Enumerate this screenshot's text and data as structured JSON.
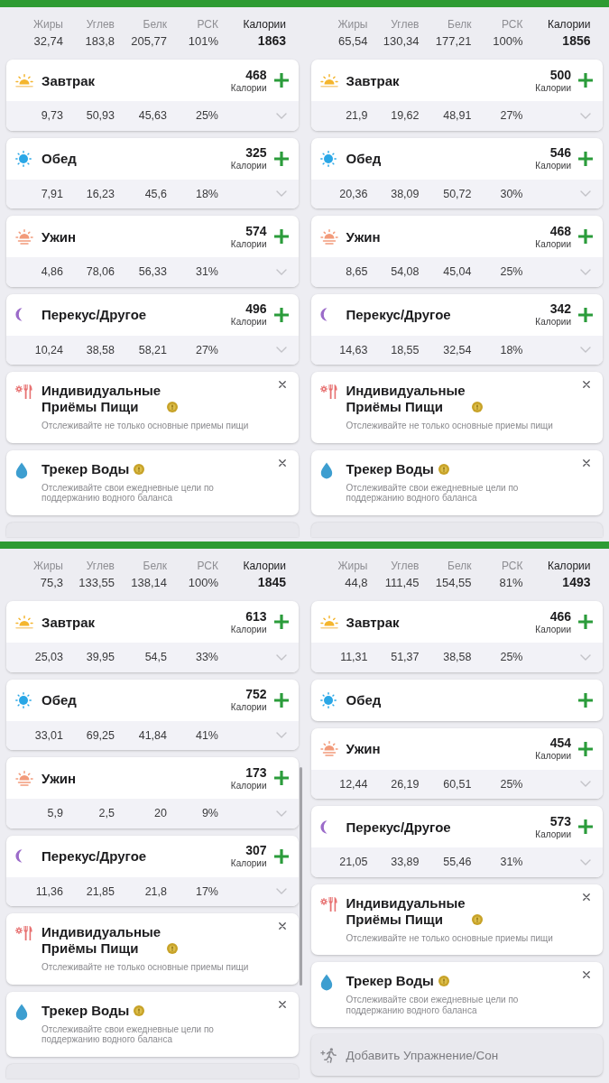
{
  "panels": [
    {
      "header": {
        "columns": [
          {
            "label": "Жиры",
            "value": "32,74"
          },
          {
            "label": "Углев",
            "value": "183,8"
          },
          {
            "label": "Белк",
            "value": "205,77"
          },
          {
            "label": "РСК",
            "value": "101%"
          },
          {
            "label": "Калории",
            "value": "1863"
          }
        ]
      },
      "meals": [
        {
          "kind": "breakfast",
          "name": "Завтрак",
          "calories": "468",
          "calories_label": "Калории",
          "macros": [
            "9,73",
            "50,93",
            "45,63",
            "25%"
          ]
        },
        {
          "kind": "lunch",
          "name": "Обед",
          "calories": "325",
          "calories_label": "Калории",
          "macros": [
            "7,91",
            "16,23",
            "45,6",
            "18%"
          ]
        },
        {
          "kind": "dinner",
          "name": "Ужин",
          "calories": "574",
          "calories_label": "Калории",
          "macros": [
            "4,86",
            "78,06",
            "56,33",
            "31%"
          ]
        },
        {
          "kind": "snack",
          "name": "Перекус/Другое",
          "calories": "496",
          "calories_label": "Калории",
          "macros": [
            "10,24",
            "38,58",
            "58,21",
            "27%"
          ]
        }
      ],
      "promos": [
        {
          "kind": "custom_meals",
          "title": "Индивидуальные Приёмы Пищи",
          "description": "Отслеживайте не только основные приемы пищи"
        },
        {
          "kind": "water",
          "title": "Трекер Воды",
          "description": "Отслеживайте свои ежедневные цели по поддержанию водного баланса"
        }
      ],
      "exercise_button": {
        "cut_off": true
      }
    },
    {
      "header": {
        "columns": [
          {
            "label": "Жиры",
            "value": "65,54"
          },
          {
            "label": "Углев",
            "value": "130,34"
          },
          {
            "label": "Белк",
            "value": "177,21"
          },
          {
            "label": "РСК",
            "value": "100%"
          },
          {
            "label": "Калории",
            "value": "1856"
          }
        ]
      },
      "meals": [
        {
          "kind": "breakfast",
          "name": "Завтрак",
          "calories": "500",
          "calories_label": "Калории",
          "macros": [
            "21,9",
            "19,62",
            "48,91",
            "27%"
          ]
        },
        {
          "kind": "lunch",
          "name": "Обед",
          "calories": "546",
          "calories_label": "Калории",
          "macros": [
            "20,36",
            "38,09",
            "50,72",
            "30%"
          ]
        },
        {
          "kind": "dinner",
          "name": "Ужин",
          "calories": "468",
          "calories_label": "Калории",
          "macros": [
            "8,65",
            "54,08",
            "45,04",
            "25%"
          ]
        },
        {
          "kind": "snack",
          "name": "Перекус/Другое",
          "calories": "342",
          "calories_label": "Калории",
          "macros": [
            "14,63",
            "18,55",
            "32,54",
            "18%"
          ]
        }
      ],
      "promos": [
        {
          "kind": "custom_meals",
          "title": "Индивидуальные Приёмы Пищи",
          "description": "Отслеживайте не только основные приемы пищи"
        },
        {
          "kind": "water",
          "title": "Трекер Воды",
          "description": "Отслеживайте свои ежедневные цели по поддержанию водного баланса"
        }
      ],
      "exercise_button": {
        "cut_off": true
      }
    },
    {
      "header": {
        "columns": [
          {
            "label": "Жиры",
            "value": "75,3"
          },
          {
            "label": "Углев",
            "value": "133,55"
          },
          {
            "label": "Белк",
            "value": "138,14"
          },
          {
            "label": "РСК",
            "value": "100%"
          },
          {
            "label": "Калории",
            "value": "1845"
          }
        ]
      },
      "meals": [
        {
          "kind": "breakfast",
          "name": "Завтрак",
          "calories": "613",
          "calories_label": "Калории",
          "macros": [
            "25,03",
            "39,95",
            "54,5",
            "33%"
          ]
        },
        {
          "kind": "lunch",
          "name": "Обед",
          "calories": "752",
          "calories_label": "Калории",
          "macros": [
            "33,01",
            "69,25",
            "41,84",
            "41%"
          ]
        },
        {
          "kind": "dinner",
          "name": "Ужин",
          "calories": "173",
          "calories_label": "Калории",
          "macros": [
            "5,9",
            "2,5",
            "20",
            "9%"
          ]
        },
        {
          "kind": "snack",
          "name": "Перекус/Другое",
          "calories": "307",
          "calories_label": "Калории",
          "macros": [
            "11,36",
            "21,85",
            "21,8",
            "17%"
          ]
        }
      ],
      "promos": [
        {
          "kind": "custom_meals",
          "title": "Индивидуальные Приёмы Пищи",
          "description": "Отслеживайте не только основные приемы пищи"
        },
        {
          "kind": "water",
          "title": "Трекер Воды",
          "description": "Отслеживайте свои ежедневные цели по поддержанию водного баланса"
        }
      ],
      "exercise_button": {
        "cut_off": true
      },
      "scrollbar": true
    },
    {
      "header": {
        "columns": [
          {
            "label": "Жиры",
            "value": "44,8"
          },
          {
            "label": "Углев",
            "value": "111,45"
          },
          {
            "label": "Белк",
            "value": "154,55"
          },
          {
            "label": "РСК",
            "value": "81%"
          },
          {
            "label": "Калории",
            "value": "1493"
          }
        ]
      },
      "meals": [
        {
          "kind": "breakfast",
          "name": "Завтрак",
          "calories": "466",
          "calories_label": "Калории",
          "macros": [
            "11,31",
            "51,37",
            "38,58",
            "25%"
          ]
        },
        {
          "kind": "lunch",
          "name": "Обед"
        },
        {
          "kind": "dinner",
          "name": "Ужин",
          "calories": "454",
          "calories_label": "Калории",
          "macros": [
            "12,44",
            "26,19",
            "60,51",
            "25%"
          ]
        },
        {
          "kind": "snack",
          "name": "Перекус/Другое",
          "calories": "573",
          "calories_label": "Калории",
          "macros": [
            "21,05",
            "33,89",
            "55,46",
            "31%"
          ]
        }
      ],
      "promos": [
        {
          "kind": "custom_meals",
          "title": "Индивидуальные Приёмы Пищи",
          "description": "Отслеживайте не только основные приемы пищи"
        },
        {
          "kind": "water",
          "title": "Трекер Воды",
          "description": "Отслеживайте свои ежедневные цели по поддержанию водного баланса"
        }
      ],
      "exercise_button": {
        "cut_off": false,
        "label": "Добавить Упражнение/Сон"
      }
    }
  ]
}
